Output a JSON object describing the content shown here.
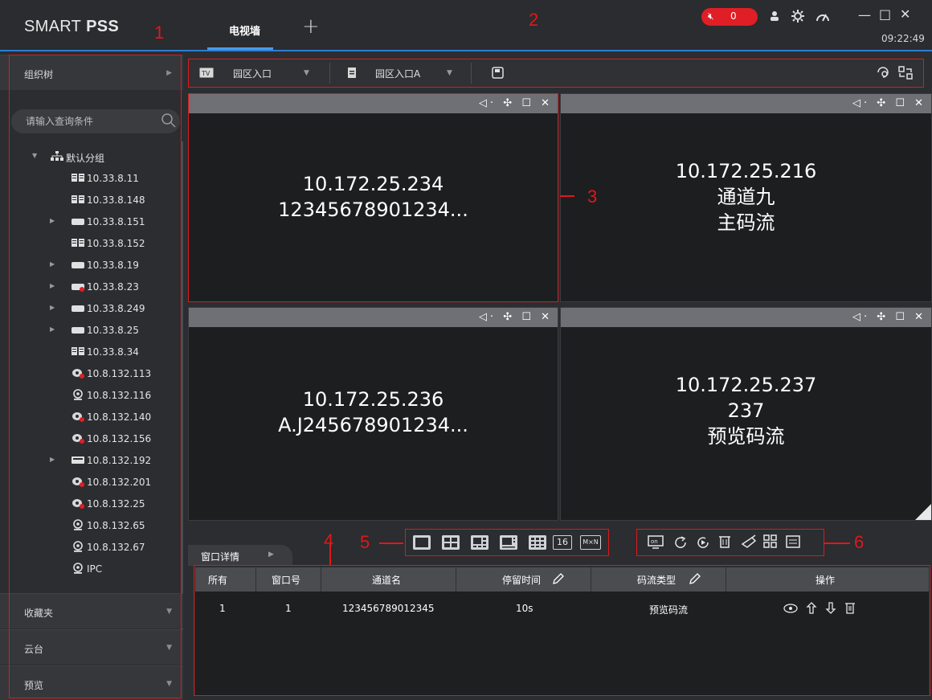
{
  "app": {
    "brand": "SMART",
    "brand_bold": "PSS",
    "tab": "电视墙",
    "add": "+",
    "alarm_count": "0",
    "clock": "09:22:49",
    "win": {
      "min": "—",
      "max": "□",
      "close": "✕"
    }
  },
  "annot": {
    "n1": "1",
    "n2": "2",
    "n3": "3",
    "n4": "4",
    "n5": "5",
    "n6": "6"
  },
  "left": {
    "org_tree": "组织树",
    "search_placeholder": "请输入查询条件",
    "group": "默认分组",
    "devices": [
      {
        "label": "10.33.8.11",
        "icon": "nvr-icon",
        "expandable": false
      },
      {
        "label": "10.33.8.148",
        "icon": "nvr-icon",
        "expandable": false
      },
      {
        "label": "10.33.8.151",
        "icon": "dvr-icon",
        "expandable": true
      },
      {
        "label": "10.33.8.152",
        "icon": "nvr-icon",
        "expandable": false
      },
      {
        "label": "10.33.8.19",
        "icon": "dvr-icon",
        "expandable": true
      },
      {
        "label": "10.33.8.23",
        "icon": "dvr-offline-icon",
        "expandable": true
      },
      {
        "label": "10.33.8.249",
        "icon": "dvr-icon",
        "expandable": true
      },
      {
        "label": "10.33.8.25",
        "icon": "dvr-icon",
        "expandable": true
      },
      {
        "label": "10.33.8.34",
        "icon": "nvr-icon",
        "expandable": false
      },
      {
        "label": "10.8.132.113",
        "icon": "camera-offline-icon",
        "expandable": false
      },
      {
        "label": "10.8.132.116",
        "icon": "ipc-icon",
        "expandable": false
      },
      {
        "label": "10.8.132.140",
        "icon": "camera-offline-icon",
        "expandable": false
      },
      {
        "label": "10.8.132.156",
        "icon": "camera-offline-icon",
        "expandable": false
      },
      {
        "label": "10.8.132.192",
        "icon": "encoder-icon",
        "expandable": true
      },
      {
        "label": "10.8.132.201",
        "icon": "camera-offline-icon",
        "expandable": false
      },
      {
        "label": "10.8.132.25",
        "icon": "camera-offline-icon",
        "expandable": false
      },
      {
        "label": "10.8.132.65",
        "icon": "ipc-icon",
        "expandable": false
      },
      {
        "label": "10.8.132.67",
        "icon": "ipc-icon",
        "expandable": false
      },
      {
        "label": "IPC",
        "icon": "ipc-icon",
        "expandable": false
      }
    ],
    "favorites": "收藏夹",
    "ptz": "云台",
    "preview": "预览"
  },
  "toolbar": {
    "wall": "园区入口",
    "plan": "园区入口A"
  },
  "videos": [
    {
      "line1": "10.172.25.234",
      "line2": "12345678901234...",
      "line3": ""
    },
    {
      "line1": "10.172.25.216",
      "line2": "通道九",
      "line3": "主码流"
    },
    {
      "line1": "10.172.25.236",
      "line2": "A.J245678901234...",
      "line3": ""
    },
    {
      "line1": "10.172.25.237",
      "line2": "237",
      "line3": "预览码流"
    }
  ],
  "bottom": {
    "detail_tab": "窗口详情",
    "layout16": "16",
    "layoutMN": "M×N",
    "headers": {
      "all": "所有",
      "window": "窗口号",
      "channel": "通道名",
      "dwell": "停留时间",
      "stream": "码流类型",
      "ops": "操作"
    },
    "row": {
      "all": "1",
      "window": "1",
      "channel": "123456789012345",
      "dwell": "10s",
      "stream": "预览码流"
    }
  },
  "colors": {
    "accent": "#2d7ed1",
    "annotation": "#e0181b",
    "alarm": "#e01e25"
  }
}
